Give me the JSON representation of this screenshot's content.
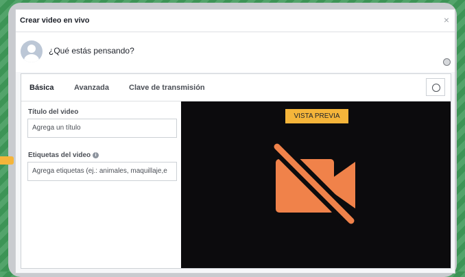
{
  "dialog": {
    "title": "Crear video en vivo",
    "close_label": "×"
  },
  "composer": {
    "prompt": "¿Qué estás pensando?"
  },
  "tabs": [
    {
      "label": "Básica",
      "active": true
    },
    {
      "label": "Avanzada",
      "active": false
    },
    {
      "label": "Clave de transmisión",
      "active": false
    }
  ],
  "form": {
    "title_label": "Título del video",
    "title_placeholder": "Agrega un título",
    "tags_label": "Etiquetas del video",
    "tags_placeholder": "Agrega etiquetas (ej.: animales, maquillaje,e"
  },
  "preview": {
    "badge": "VISTA PREVIA",
    "icon": "camera-off-icon"
  },
  "colors": {
    "accent": "#f5b53a",
    "icon": "#f0824a",
    "preview_bg": "#0c0b0d",
    "background": "#3f9a5a"
  }
}
